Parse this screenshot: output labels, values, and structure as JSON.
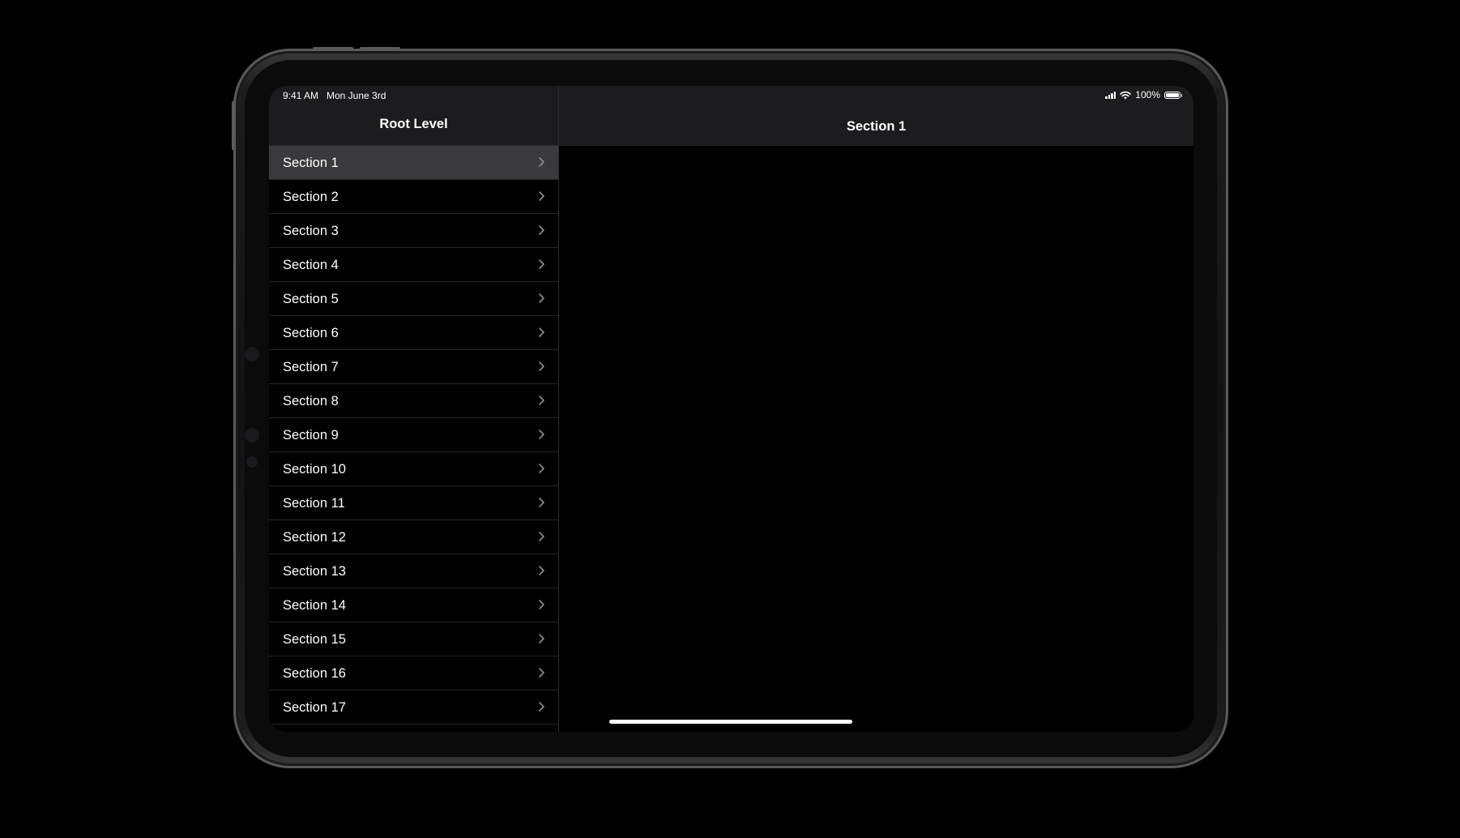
{
  "status_bar": {
    "time": "9:41 AM",
    "date": "Mon June 3rd",
    "battery_percent": "100%",
    "battery_level": 1.0,
    "icons": [
      "signal-icon",
      "wifi-icon",
      "battery-icon"
    ]
  },
  "master": {
    "title": "Root Level",
    "selected_index": 0,
    "items": [
      {
        "label": "Section 1"
      },
      {
        "label": "Section 2"
      },
      {
        "label": "Section 3"
      },
      {
        "label": "Section 4"
      },
      {
        "label": "Section 5"
      },
      {
        "label": "Section 6"
      },
      {
        "label": "Section 7"
      },
      {
        "label": "Section 8"
      },
      {
        "label": "Section 9"
      },
      {
        "label": "Section 10"
      },
      {
        "label": "Section 11"
      },
      {
        "label": "Section 12"
      },
      {
        "label": "Section 13"
      },
      {
        "label": "Section 14"
      },
      {
        "label": "Section 15"
      },
      {
        "label": "Section 16"
      },
      {
        "label": "Section 17"
      }
    ]
  },
  "detail": {
    "title": "Section 1"
  },
  "colors": {
    "background": "#000000",
    "bar": "#1c1c1e",
    "selected_row": "#3a3a3c",
    "text": "#ffffff",
    "chevron": "#8e8e93"
  }
}
